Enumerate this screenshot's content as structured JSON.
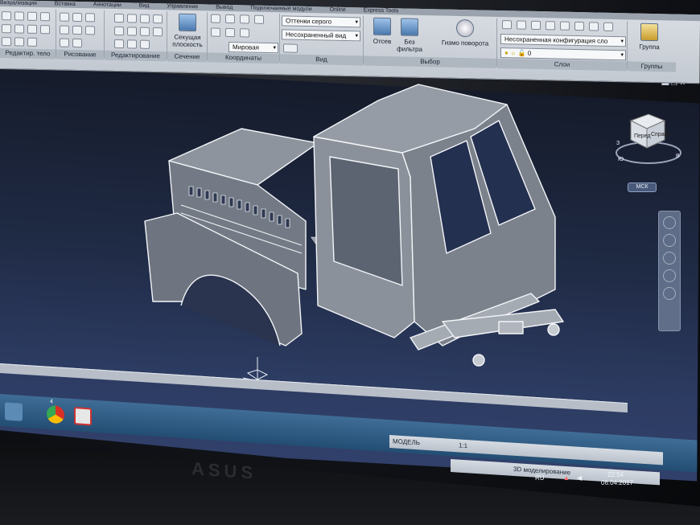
{
  "ribbon": {
    "tabs": [
      "Визуализация",
      "Вставка",
      "Аннотации",
      "Вид",
      "Управление",
      "Вывод",
      "Подключаемые модули",
      "Online",
      "Express Tools"
    ],
    "groups": {
      "solid_edit": "Редактир. тело",
      "draw": "Рисование",
      "modify": "Редактирование",
      "section": "Сечение",
      "coordinates": "Координаты",
      "view": "Вид",
      "selection": "Выбор",
      "layers": "Слои",
      "groups": "Группы"
    },
    "section_plane_label": "Секущая плоскость",
    "visual_style": "Оттенки серого",
    "saved_view": "Несохраненный вид",
    "ucs_world": "Мировая",
    "culling_label": "Отсев",
    "no_filter_label": "Без фильтра",
    "gizmo_label": "Гизмо поворота",
    "layer_state": "Несохраненная конфигурация сло",
    "current_layer": "0",
    "group_label": "Группа"
  },
  "viewport": {
    "viewcube": {
      "front": "Перед",
      "right": "Справа",
      "south": "Ю",
      "west": "З",
      "east": "В"
    },
    "ucs_label": "МСК"
  },
  "taskbar": {
    "badge_count": "4"
  },
  "status": {
    "model_label": "МОДЕЛЬ",
    "scale_label": "1:1",
    "workspace": "3D моделирование"
  },
  "tray": {
    "language": "RU",
    "time": "22:54",
    "date": "06.04.2017"
  },
  "bezel": {
    "brand": "ASUS"
  },
  "colors": {
    "viewport_bg": "#24304f",
    "model_edge": "#f3f5f8",
    "model_face": "#8a9099",
    "ribbon_bg": "#cdd3da"
  }
}
